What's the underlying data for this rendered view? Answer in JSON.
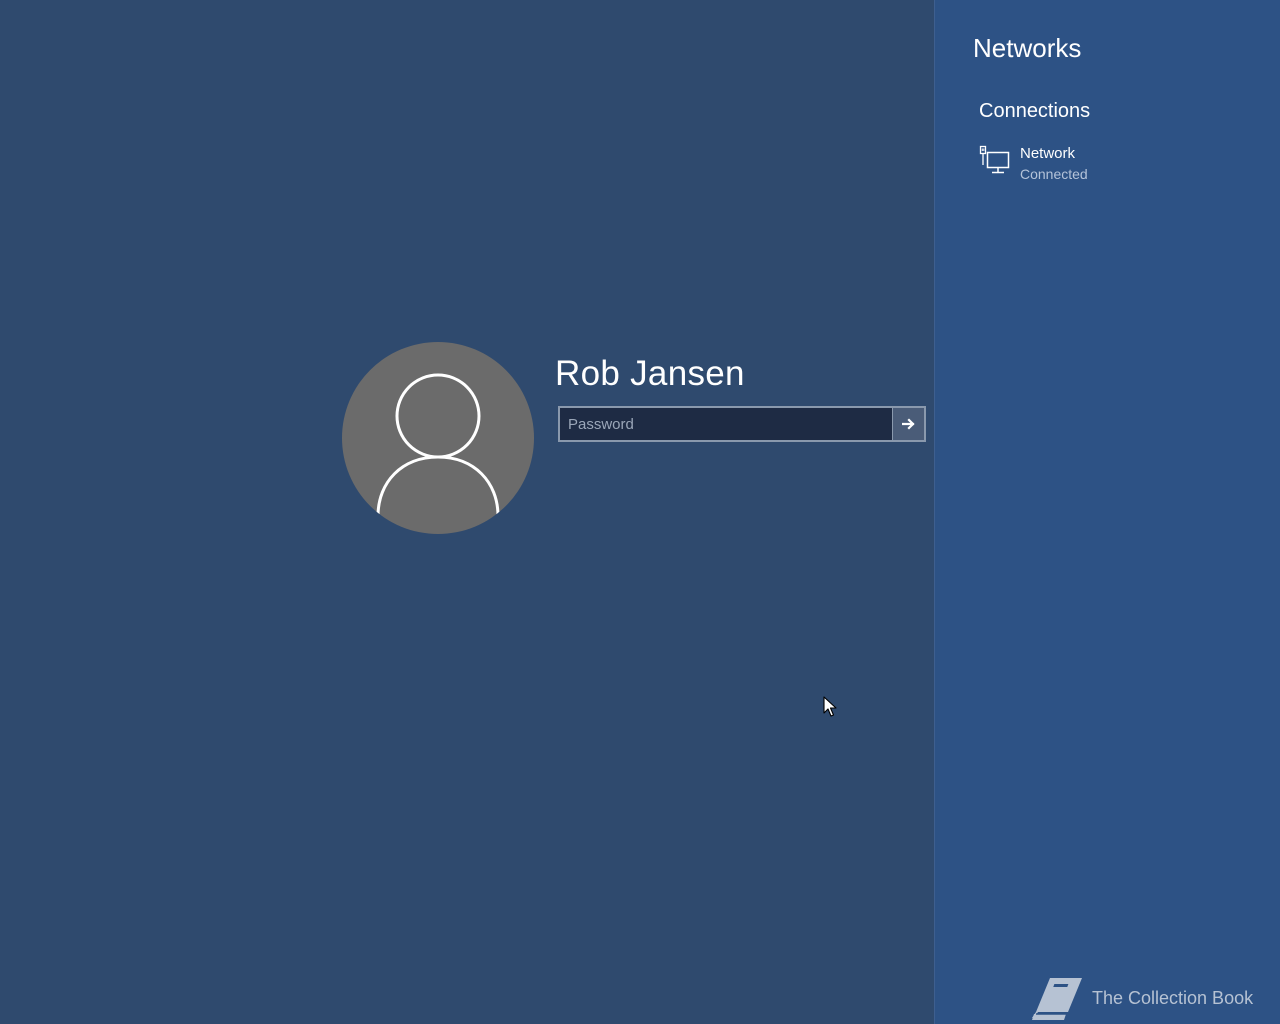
{
  "login": {
    "username": "Rob Jansen",
    "password_placeholder": "Password",
    "password_value": "",
    "submit_icon": "arrow-right-icon",
    "avatar_icon": "user-silhouette-icon"
  },
  "networks_panel": {
    "title": "Networks",
    "section_heading": "Connections",
    "items": [
      {
        "icon": "wired-network-icon",
        "name": "Network",
        "status": "Connected"
      }
    ]
  },
  "watermark": {
    "icon": "book-icon",
    "text": "The Collection Book"
  },
  "colors": {
    "background": "#2f4a6e",
    "panel_background": "#2d5285",
    "avatar_background": "#6b6b6b",
    "input_background": "#1e2b44",
    "text_primary": "#ffffff",
    "text_secondary": "#b4c3d9"
  }
}
